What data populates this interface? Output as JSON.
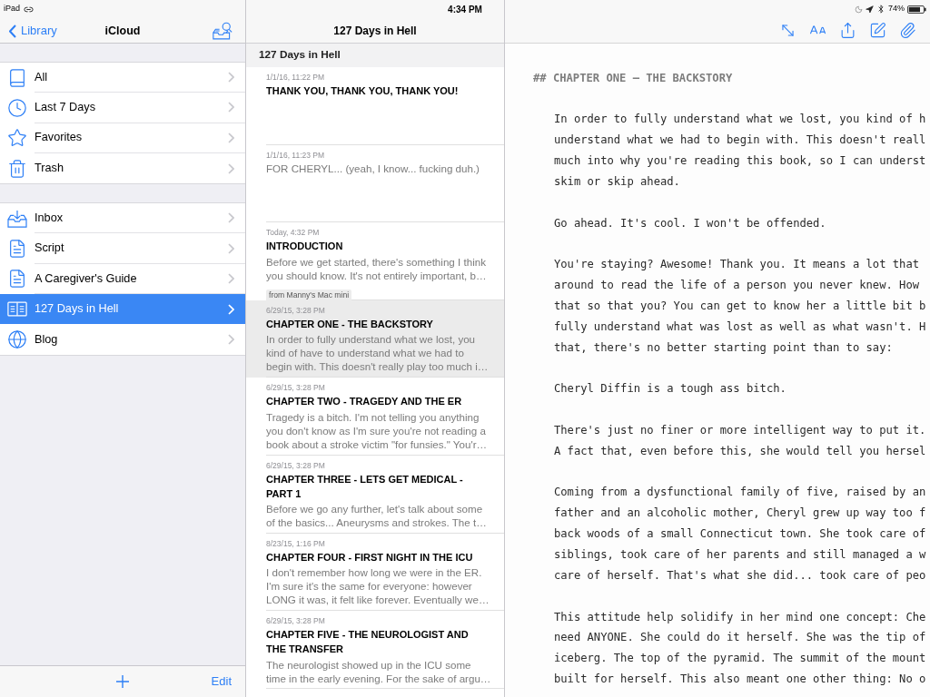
{
  "status_bar": {
    "device": "iPad",
    "time": "4:34 PM",
    "battery": "74%"
  },
  "sidebar": {
    "back": "Library",
    "title": "iCloud",
    "groups": [
      {
        "items": [
          {
            "label": "All",
            "kind": "all",
            "selected": false
          },
          {
            "label": "Last 7 Days",
            "kind": "recent",
            "selected": false
          },
          {
            "label": "Favorites",
            "kind": "favorites",
            "selected": false
          },
          {
            "label": "Trash",
            "kind": "trash",
            "selected": false
          }
        ]
      },
      {
        "items": [
          {
            "label": "Inbox",
            "kind": "inbox",
            "selected": false
          },
          {
            "label": "Script",
            "kind": "sheet",
            "selected": false
          },
          {
            "label": "A Caregiver's Guide",
            "kind": "sheet",
            "selected": false
          },
          {
            "label": "127 Days in Hell",
            "kind": "book",
            "selected": true
          },
          {
            "label": "Blog",
            "kind": "blog",
            "selected": false
          }
        ]
      }
    ],
    "edit": "Edit"
  },
  "note_list": {
    "title": "127 Days in Hell",
    "section": "127 Days in Hell",
    "notes": [
      {
        "date": "1/1/16, 11:22 PM",
        "title": [
          "THANK YOU, THANK YOU, THANK YOU!"
        ],
        "selected": false
      },
      {
        "date": "1/1/16, 11:23 PM",
        "preview": [
          "FOR CHERYL... (yeah, I know... fucking duh.)"
        ],
        "selected": false
      },
      {
        "date": "Today, 4:32 PM",
        "title": [
          "INTRODUCTION"
        ],
        "preview": [
          "Before we get started, there's something I think",
          "you should know. It's not entirely important, b…"
        ],
        "source": "from Manny's Mac mini",
        "selected": false
      },
      {
        "date": "6/29/15, 3:28 PM",
        "title": [
          "CHAPTER ONE - THE BACKSTORY"
        ],
        "preview": [
          "In order to fully understand what we lost, you",
          "kind of have to understand what we had to",
          "begin with. This doesn't really play too much i…"
        ],
        "selected": true
      },
      {
        "date": "6/29/15, 3:28 PM",
        "title": [
          "CHAPTER TWO - TRAGEDY AND THE ER"
        ],
        "preview": [
          "Tragedy is a bitch. I'm not telling you anything",
          "you don't know as I'm sure you're not reading a",
          "book about a stroke victim \"for funsies.\" You'r…"
        ],
        "selected": false
      },
      {
        "date": "6/29/15, 3:28 PM",
        "title": [
          "CHAPTER THREE - LETS GET MEDICAL -",
          "PART 1"
        ],
        "preview": [
          "Before we go any further, let's talk about some",
          "of the basics... Aneurysms and strokes. The t…"
        ],
        "selected": false
      },
      {
        "date": "8/23/15, 1:16 PM",
        "title": [
          "CHAPTER FOUR - FIRST NIGHT IN THE ICU"
        ],
        "preview": [
          "I don't remember how long we were in the ER.",
          "I'm sure it's the same for everyone: however",
          "LONG it was, it felt like forever. Eventually we…"
        ],
        "selected": false
      },
      {
        "date": "6/29/15, 3:28 PM",
        "title": [
          "CHAPTER FIVE - THE NEUROLOGIST AND",
          "THE TRANSFER"
        ],
        "preview": [
          "The neurologist showed up in the ICU some",
          "time in the early evening. For the sake of argu…"
        ],
        "selected": false
      }
    ]
  },
  "editor": {
    "heading": "## CHAPTER ONE — THE BACKSTORY",
    "paragraphs": [
      [
        "In order to fully understand what we lost, you kind of h",
        "understand what we had to begin with. This doesn't reall",
        "much into why you're reading this book, so I can underst",
        "skim or skip ahead."
      ],
      [
        "Go ahead. It's cool. I won't be offended."
      ],
      [
        "You're staying? Awesome! Thank you. It means a lot that",
        "around to read the life of a person you never knew. How",
        "that so that you? You can get to know her a little bit b",
        "fully understand what was lost as well as what wasn't. H",
        "that, there's no better starting point than to say:"
      ],
      [
        "Cheryl Diffin is a tough ass bitch."
      ],
      [
        "There's just no finer or more intelligent way to put it.",
        "A fact that, even before this, she would tell you hersel"
      ],
      [
        "Coming from a dysfunctional family of five, raised by an",
        "father and an alcoholic mother, Cheryl grew up way too f",
        "back woods of a small Connecticut town. She took care of",
        "siblings, took care of her parents and still managed a w",
        "care of herself. That's what she did... took care of peo"
      ],
      [
        "This attitude help solidify in her mind one concept: Che",
        "need ANYONE. She could do it herself. She was the tip of",
        "iceberg. The top of the pyramid. The summit of the mount",
        "built for herself. This also meant one other thing: No o"
      ]
    ]
  }
}
